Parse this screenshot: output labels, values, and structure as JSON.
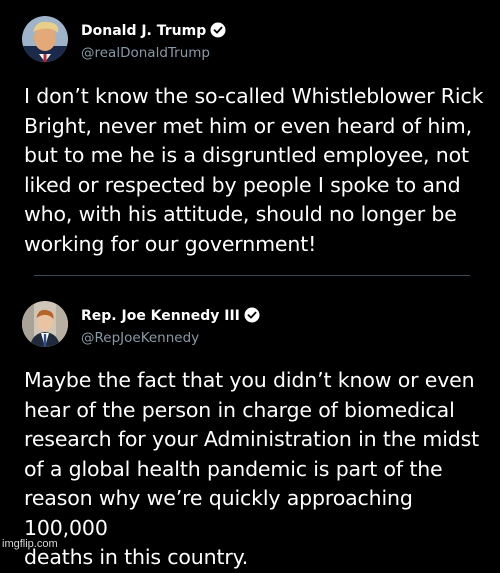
{
  "tweets": [
    {
      "author": {
        "name": "Donald J. Trump",
        "handle": "@realDonaldTrump",
        "verified": true,
        "avatar_icon": "avatar-trump"
      },
      "text": "I don’t know the so-called Whistleblower Rick\nBright, never met him or even heard of him,\nbut to me he is a disgruntled employee, not\nliked or respected by people I spoke to and\nwho, with his attitude, should no longer be\nworking for our government!"
    },
    {
      "author": {
        "name": "Rep. Joe Kennedy III",
        "handle": "@RepJoeKennedy",
        "verified": true,
        "avatar_icon": "avatar-kennedy"
      },
      "text": "Maybe the fact that you didn’t know or even\nhear of the person in charge of biomedical\nresearch for your Administration in the midst\nof a global health pandemic is part of the\nreason why we’re quickly approaching 100,000\ndeaths in this country."
    }
  ],
  "watermark": "imgflip.com",
  "colors": {
    "background": "#000000",
    "text": "#ffffff",
    "handle": "#8899a6",
    "divider": "#3d4a56"
  }
}
